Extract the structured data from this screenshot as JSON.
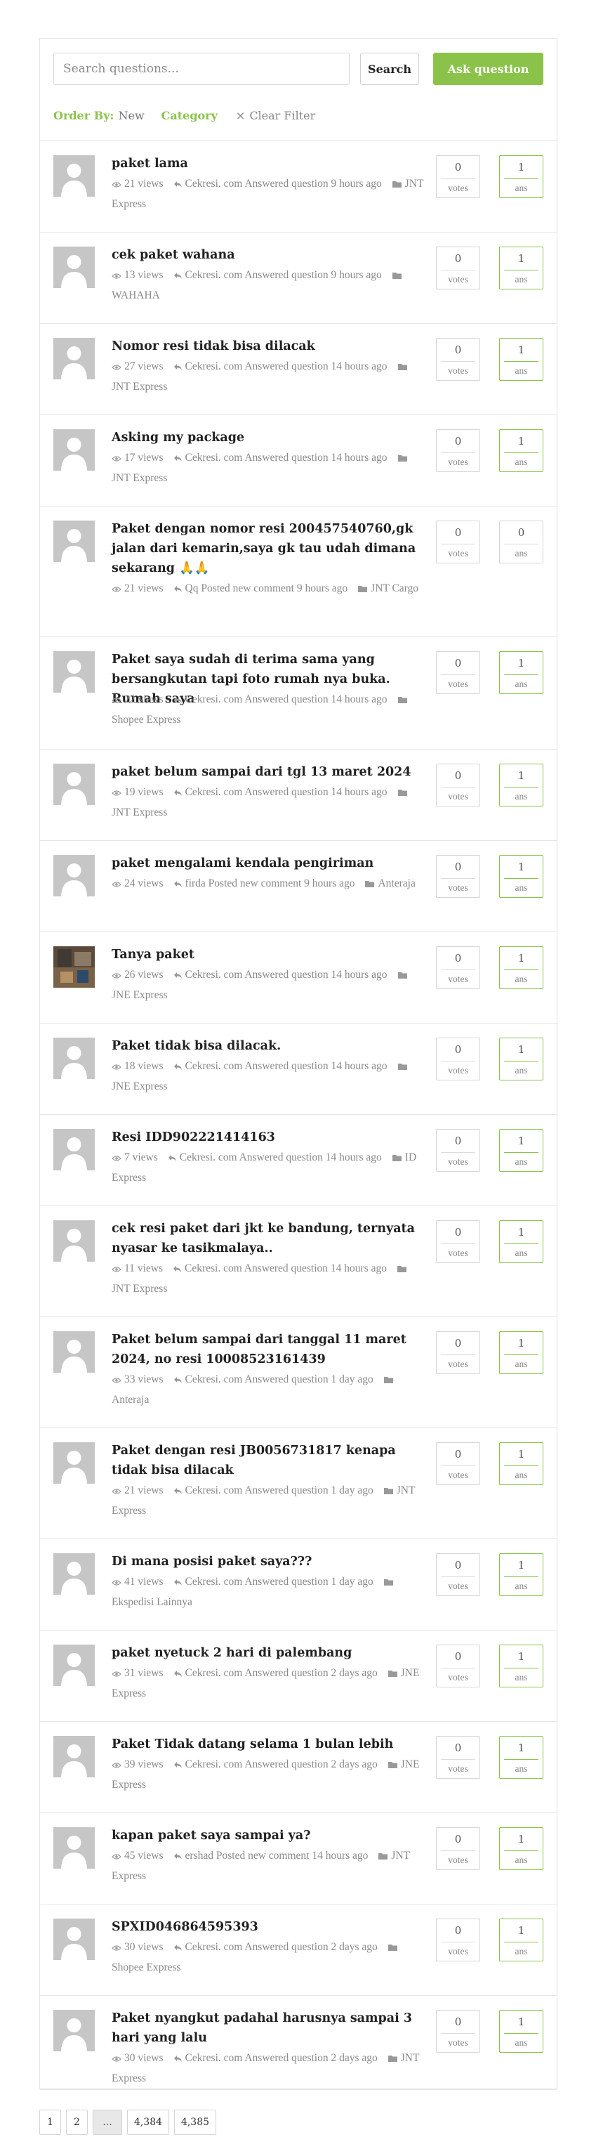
{
  "search": {
    "placeholder": "Search questions...",
    "button_label": "Search",
    "ask_label": "Ask question"
  },
  "filters": {
    "order_label": "Order By:",
    "order_value": "New",
    "category_label": "Category",
    "clear_label": "Clear Filter"
  },
  "meta_words": {
    "views": "views",
    "votes": "votes",
    "ans": "ans"
  },
  "questions": [
    {
      "title": "paket lama",
      "views": "21",
      "activity": "Cekresi. com Answered question 9 hours ago",
      "category": "JNT Express",
      "votes": "0",
      "answers": "1"
    },
    {
      "title": "cek paket wahana",
      "views": "13",
      "activity": "Cekresi. com Answered question 9 hours ago",
      "category": "WAHAHA",
      "votes": "0",
      "answers": "1"
    },
    {
      "title": "Nomor resi tidak bisa dilacak",
      "views": "27",
      "activity": "Cekresi. com Answered question 14 hours ago",
      "category": "JNT Express",
      "votes": "0",
      "answers": "1"
    },
    {
      "title": "Asking my package",
      "views": "17",
      "activity": "Cekresi. com Answered question 14 hours ago",
      "category": "JNT Express",
      "votes": "0",
      "answers": "1"
    },
    {
      "title": "Paket dengan nomor resi 200457540760,gk jalan dari kemarin,saya gk tau udah dimana sekarang 🙏🙏",
      "views": "21",
      "activity": "Qq Posted new comment 9 hours ago",
      "category": "JNT Cargo",
      "votes": "0",
      "answers": "0"
    },
    {
      "title": "Paket saya sudah di terima sama yang bersangkutan tapi foto rumah nya buka. Rumah saya",
      "views": "22",
      "activity": "Cekresi. com Answered question 14 hours ago",
      "category": "Shopee Express",
      "votes": "0",
      "answers": "1"
    },
    {
      "title": "paket belum sampai dari tgl 13 maret 2024",
      "views": "19",
      "activity": "Cekresi. com Answered question 14 hours ago",
      "category": "JNT Express",
      "votes": "0",
      "answers": "1"
    },
    {
      "title": "paket mengalami kendala pengiriman",
      "views": "24",
      "activity": "firda Posted new comment 9 hours ago",
      "category": "Anteraja",
      "votes": "0",
      "answers": "1"
    },
    {
      "title": "Tanya paket",
      "views": "26",
      "activity": "Cekresi. com Answered question 14 hours ago",
      "category": "JNE Express",
      "votes": "0",
      "answers": "1"
    },
    {
      "title": "Paket tidak bisa dilacak.",
      "views": "18",
      "activity": "Cekresi. com Answered question 14 hours ago",
      "category": "JNE Express",
      "votes": "0",
      "answers": "1"
    },
    {
      "title": "Resi IDD902221414163",
      "views": "7",
      "activity": "Cekresi. com Answered question 14 hours ago",
      "category": "ID Express",
      "votes": "0",
      "answers": "1"
    },
    {
      "title": "cek resi paket dari jkt ke bandung, ternyata nyasar ke tasikmalaya..",
      "views": "11",
      "activity": "Cekresi. com Answered question 14 hours ago",
      "category": "JNT Express",
      "votes": "0",
      "answers": "1"
    },
    {
      "title": "Paket belum sampai dari tanggal 11 maret 2024, no resi 10008523161439",
      "views": "33",
      "activity": "Cekresi. com Answered question 1 day ago",
      "category": "Anteraja",
      "votes": "0",
      "answers": "1"
    },
    {
      "title": "Paket dengan resi JB0056731817 kenapa tidak bisa dilacak",
      "views": "21",
      "activity": "Cekresi. com Answered question 1 day ago",
      "category": "JNT Express",
      "votes": "0",
      "answers": "1"
    },
    {
      "title": "Di mana posisi paket saya???",
      "views": "41",
      "activity": "Cekresi. com Answered question 1 day ago",
      "category": "Ekspedisi Lainnya",
      "votes": "0",
      "answers": "1"
    },
    {
      "title": "paket nyetuck 2 hari di palembang",
      "views": "31",
      "activity": "Cekresi. com Answered question 2 days ago",
      "category": "JNE Express",
      "votes": "0",
      "answers": "1"
    },
    {
      "title": "Paket Tidak datang selama 1 bulan lebih",
      "views": "39",
      "activity": "Cekresi. com Answered question 2 days ago",
      "category": "JNE Express",
      "votes": "0",
      "answers": "1"
    },
    {
      "title": "kapan paket saya sampai ya?",
      "views": "45",
      "activity": "ershad Posted new comment 14 hours ago",
      "category": "JNT Express",
      "votes": "0",
      "answers": "1"
    },
    {
      "title": "SPXID046864595393",
      "views": "30",
      "activity": "Cekresi. com Answered question 2 days ago",
      "category": "Shopee Express",
      "votes": "0",
      "answers": "1"
    },
    {
      "title": "Paket nyangkut padahal harusnya sampai 3 hari yang lalu",
      "views": "30",
      "activity": "Cekresi. com Answered question 2 days ago",
      "category": "JNT Express",
      "votes": "0",
      "answers": "1"
    }
  ],
  "pagination": [
    "1",
    "2",
    "...",
    "4,384",
    "4,385"
  ]
}
